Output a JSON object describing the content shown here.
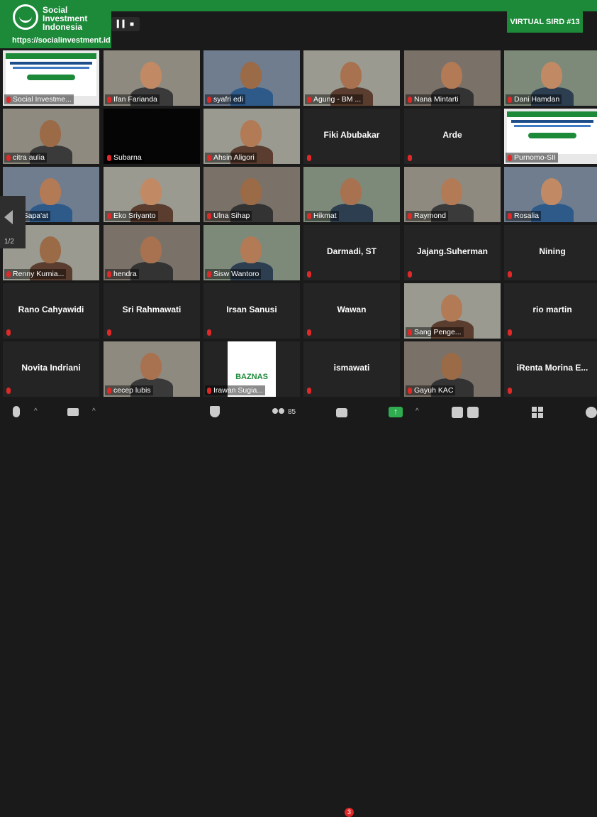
{
  "brand": {
    "name": "Social Investment Indonesia",
    "url": "https://socialinvestment.id"
  },
  "event_badge": "VIRTUAL SIRD #13",
  "view_controls": "▍▍ ■",
  "pager": {
    "page": "1/2"
  },
  "tiles": [
    {
      "name": "Social Investme...",
      "type": "slide"
    },
    {
      "name": "Ifan Farianda",
      "type": "video"
    },
    {
      "name": "syafri edi",
      "type": "video"
    },
    {
      "name": "Agung - BM ...",
      "type": "video"
    },
    {
      "name": "Nana Mintarti",
      "type": "video"
    },
    {
      "name": "Dani Hamdan",
      "type": "video"
    },
    {
      "name": "citra aulia",
      "type": "video"
    },
    {
      "name": "Subarna",
      "type": "black"
    },
    {
      "name": "Ahsin Aligori",
      "type": "video"
    },
    {
      "name": "Fiki Abubakar",
      "type": "name"
    },
    {
      "name": "Arde",
      "type": "name"
    },
    {
      "name": "Purnomo-SII",
      "type": "slide"
    },
    {
      "name": "ep Sapa'at",
      "type": "video"
    },
    {
      "name": "Eko Sriyanto",
      "type": "video"
    },
    {
      "name": "Ulna Sihap",
      "type": "video"
    },
    {
      "name": "Hikmat",
      "type": "video"
    },
    {
      "name": "Raymond",
      "type": "video"
    },
    {
      "name": "Rosalia",
      "type": "video"
    },
    {
      "name": "Renny Kurnia...",
      "type": "video"
    },
    {
      "name": "hendra",
      "type": "video"
    },
    {
      "name": "Sisw Wantoro",
      "type": "video"
    },
    {
      "name": "Darmadi, ST",
      "type": "name"
    },
    {
      "name": "Jajang.Suherman",
      "type": "name"
    },
    {
      "name": "Nining",
      "type": "name"
    },
    {
      "name": "Rano Cahyawidi",
      "type": "name"
    },
    {
      "name": "Sri Rahmawati",
      "type": "name"
    },
    {
      "name": "Irsan Sanusi",
      "type": "name"
    },
    {
      "name": "Wawan",
      "type": "name"
    },
    {
      "name": "Sang Penge...",
      "type": "video"
    },
    {
      "name": "rio martin",
      "type": "name"
    },
    {
      "name": "Novita Indriani",
      "type": "name"
    },
    {
      "name": "cecep lubis",
      "type": "video"
    },
    {
      "name": "Irawan Sugia...",
      "type": "logo",
      "logo_text": "BAZNAS"
    },
    {
      "name": "ismawati",
      "type": "name"
    },
    {
      "name": "Gayuh KAC",
      "type": "video"
    },
    {
      "name": "iRenta Morina E...",
      "type": "name"
    }
  ],
  "toolbar": {
    "participants_count": "85",
    "chat_badge": "3"
  }
}
